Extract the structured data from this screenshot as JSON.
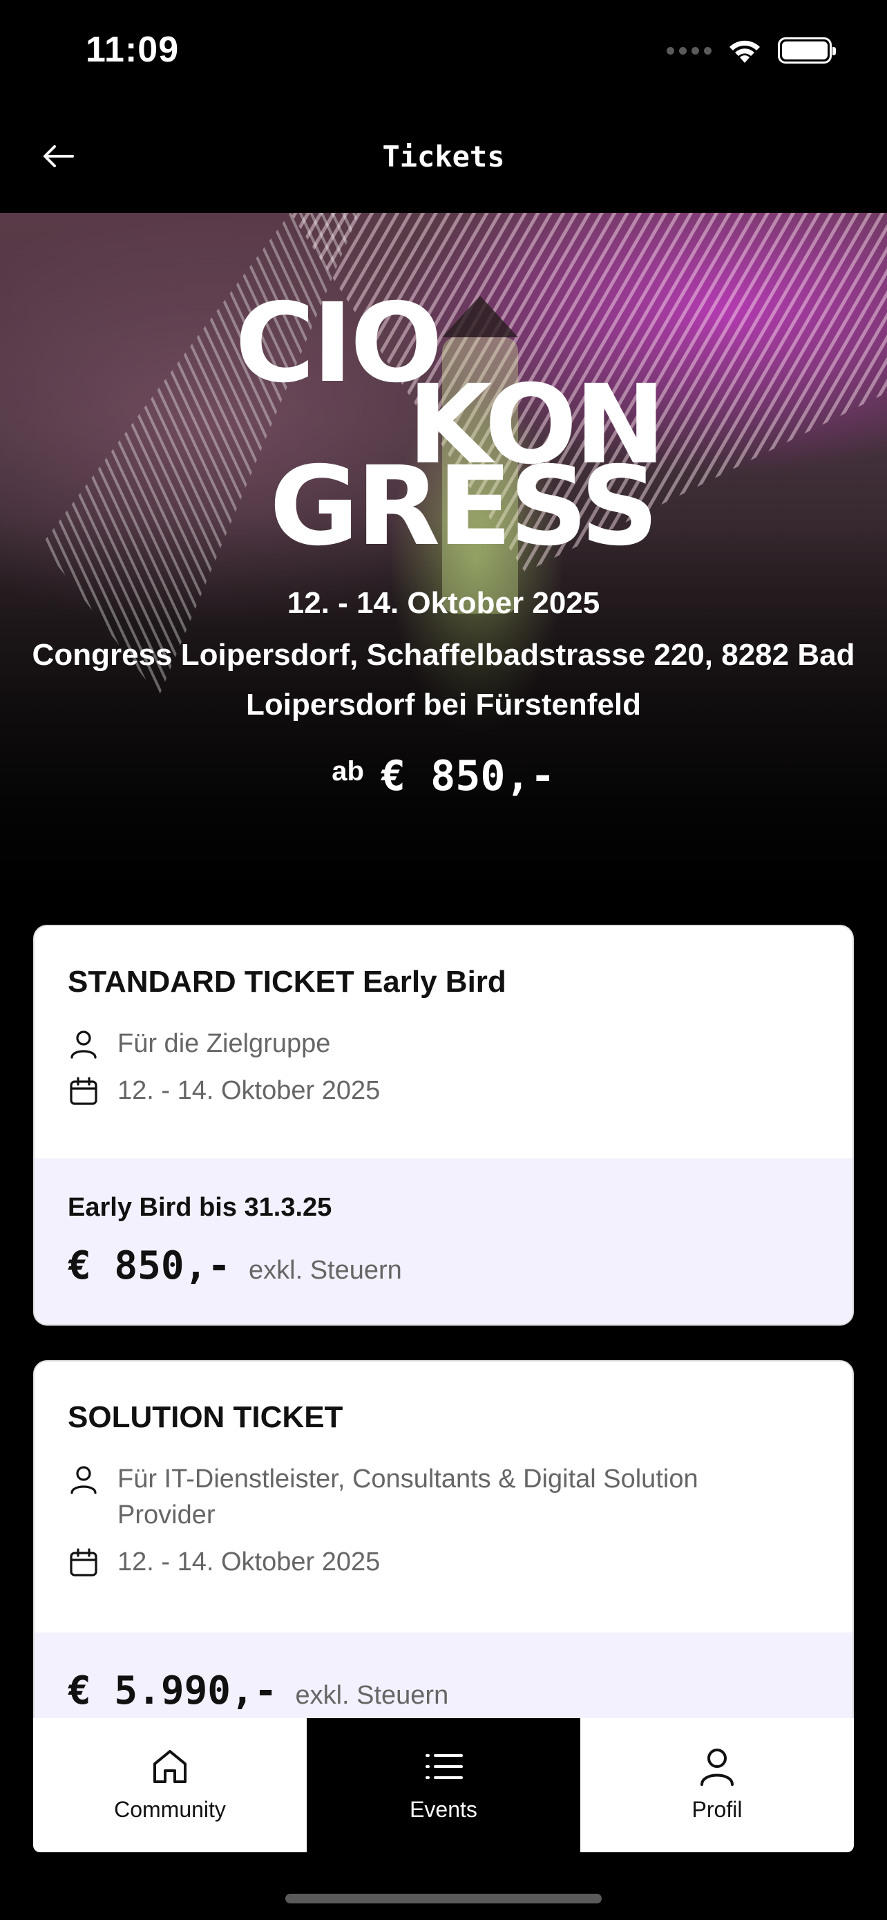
{
  "status_bar": {
    "time": "11:09"
  },
  "nav": {
    "title": "Tickets",
    "back_icon": "arrow-left-icon"
  },
  "hero": {
    "logo_lines": [
      "CIO",
      "KON",
      "GRESS"
    ],
    "date": "12. - 14. Oktober 2025",
    "venue": "Congress Loipersdorf, Schaffelbadstrasse 220, 8282 Bad Loipersdorf bei Fürstenfeld",
    "price_prefix": "ab",
    "price": "€ 850,-"
  },
  "tickets": [
    {
      "title": "STANDARD TICKET Early Bird",
      "audience": "Für die Zielgruppe",
      "dates": "12. - 14. Oktober 2025",
      "offer_label": "Early Bird bis 31.3.25",
      "price": "€ 850,-",
      "tax_note": "exkl. Steuern"
    },
    {
      "title": "SOLUTION TICKET",
      "audience": "Für IT-Dienstleister, Consultants & Digital Solution Provider",
      "dates": "12. - 14. Oktober 2025",
      "price": "€ 5.990,-",
      "tax_note": "exkl. Steuern"
    }
  ],
  "tab_bar": {
    "tabs": [
      {
        "label": "Community",
        "icon": "home-icon",
        "active": false
      },
      {
        "label": "Events",
        "icon": "list-icon",
        "active": true
      },
      {
        "label": "Profil",
        "icon": "person-icon",
        "active": false
      }
    ]
  },
  "colors": {
    "background": "#000000",
    "card": "#ffffff",
    "price_panel": "#f3f1fd",
    "muted_text": "#666666"
  }
}
